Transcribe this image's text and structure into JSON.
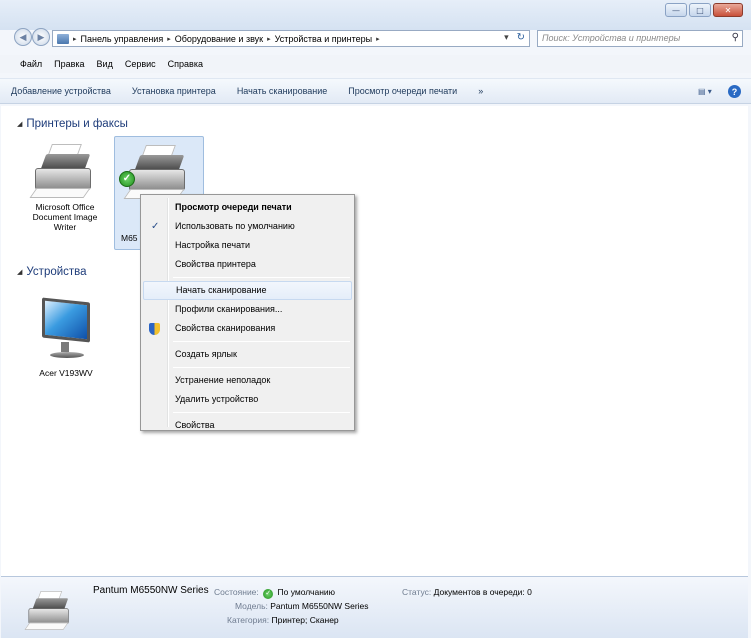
{
  "address": {
    "breadcrumbs": [
      "Панель управления",
      "Оборудование и звук",
      "Устройства и принтеры"
    ],
    "separator": "▸",
    "dropdown_glyph": "▾",
    "refresh_glyph": "↻"
  },
  "search": {
    "placeholder": "Поиск: Устройства и принтеры"
  },
  "menubar": {
    "items": [
      "Файл",
      "Правка",
      "Вид",
      "Сервис",
      "Справка"
    ]
  },
  "commandbar": {
    "items": [
      "Добавление устройства",
      "Установка принтера",
      "Начать сканирование",
      "Просмотр очереди печати"
    ],
    "more": "»",
    "view_glyph": "▤ ▾",
    "help_glyph": "?"
  },
  "groups": {
    "printers": "Принтеры и факсы",
    "devices": "Устройства",
    "expand_glyph": "◢"
  },
  "devices": {
    "msoffice": [
      "Microsoft Office",
      "Document Image",
      "Writer"
    ],
    "pantum_short": "M65",
    "monitor": "Acer V193WV"
  },
  "context_menu": {
    "items": [
      {
        "label": "Просмотр очереди печати",
        "bold": true
      },
      {
        "label": "Использовать по умолчанию",
        "mark": "✓"
      },
      {
        "label": "Настройка печати"
      },
      {
        "label": "Свойства принтера"
      },
      {
        "label": "Начать сканирование",
        "hover": true
      },
      {
        "label": "Профили сканирования..."
      },
      {
        "label": "Свойства сканирования",
        "icon": "shield-icon"
      },
      {
        "label": "Создать ярлык"
      },
      {
        "label": "Устранение неполадок"
      },
      {
        "label": "Удалить устройство"
      },
      {
        "label": "Свойства"
      }
    ]
  },
  "details": {
    "name": "Pantum M6550NW Series",
    "state_label": "Состояние:",
    "state_value": "По умолчанию",
    "status_label": "Статус:",
    "status_value": "Документов в очереди: 0",
    "model_label": "Модель:",
    "model_value": "Pantum M6550NW Series",
    "category_label": "Категория:",
    "category_value": "Принтер; Сканер"
  },
  "colors": {
    "selection": "#dbe8f8",
    "accent": "#1e3c7a"
  }
}
